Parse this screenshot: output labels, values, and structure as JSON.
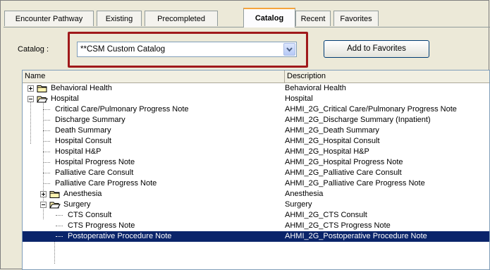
{
  "tabs": [
    {
      "label": "Encounter Pathway"
    },
    {
      "label": "Existing"
    },
    {
      "label": "Precompleted"
    },
    {
      "label": "Catalog"
    },
    {
      "label": "Recent"
    },
    {
      "label": "Favorites"
    }
  ],
  "catalog": {
    "label": "Catalog :",
    "selected": "**CSM Custom Catalog",
    "add_button": "Add to Favorites"
  },
  "columns": {
    "name": "Name",
    "description": "Description"
  },
  "rows": [
    {
      "name": "Behavioral Health",
      "desc": "Behavioral Health",
      "type": "folder",
      "state": "collapsed"
    },
    {
      "name": "Hospital",
      "desc": "Hospital",
      "type": "folder",
      "state": "expanded"
    },
    {
      "name": "Critical Care/Pulmonary Progress Note",
      "desc": "AHMI_2G_Critical Care/Pulmonary Progress Note"
    },
    {
      "name": "Discharge Summary",
      "desc": "AHMI_2G_Discharge Summary (Inpatient)"
    },
    {
      "name": "Death Summary",
      "desc": "AHMI_2G_Death Summary"
    },
    {
      "name": "Hospital Consult",
      "desc": "AHMI_2G_Hospital Consult"
    },
    {
      "name": "Hospital H&P",
      "desc": "AHMI_2G_Hospital H&P"
    },
    {
      "name": "Hospital Progress Note",
      "desc": "AHMI_2G_Hospital Progress Note"
    },
    {
      "name": "Palliative Care Consult",
      "desc": "AHMI_2G_Palliative Care Consult"
    },
    {
      "name": "Palliative Care Progress Note",
      "desc": "AHMI_2G_Palliative Care Progress Note"
    },
    {
      "name": "Anesthesia",
      "desc": "Anesthesia",
      "type": "folder",
      "state": "collapsed"
    },
    {
      "name": "Surgery",
      "desc": "Surgery",
      "type": "folder",
      "state": "expanded"
    },
    {
      "name": "CTS Consult",
      "desc": "AHMI_2G_CTS Consult"
    },
    {
      "name": "CTS Progress Note",
      "desc": "AHMI_2G_CTS Progress Note"
    },
    {
      "name": "Postoperative Procedure Note",
      "desc": "AHMI_2G_Postoperative Procedure Note",
      "selected": true
    }
  ],
  "colors": {
    "highlight_box": "#a0191b",
    "selection": "#0a246a",
    "active_tab_accent": "#f6a43b"
  },
  "icons": {
    "folder": "folder-icon",
    "expand": "plus-box-icon",
    "collapse": "minus-box-icon",
    "dropdown": "chevron-down-icon"
  }
}
